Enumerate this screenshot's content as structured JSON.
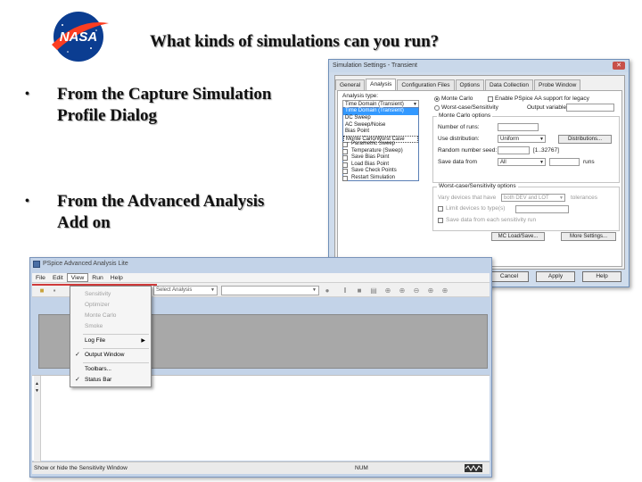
{
  "slide": {
    "logo_text": "NASA",
    "title": "What kinds of simulations can you run?",
    "bullets": [
      {
        "line1": "From the Capture Simulation",
        "line2": "Profile Dialog"
      },
      {
        "line1": "From the Advanced Analysis",
        "line2": "Add on"
      }
    ],
    "bullet_glyph": "•"
  },
  "dialog": {
    "title": "Simulation Settings - Transient",
    "tabs": [
      "General",
      "Analysis",
      "Configuration Files",
      "Options",
      "Data Collection",
      "Probe Window"
    ],
    "active_tab": "Analysis",
    "analysis_type_label": "Analysis type:",
    "analysis_type_value": "Time Domain (Transient)",
    "analysis_types": [
      "Time Domain (Transient)",
      "DC Sweep",
      "AC Sweep/Noise",
      "Bias Point",
      "Monte Carlo/Worst Case"
    ],
    "options_label": "Options",
    "options": [
      {
        "label": "Parametric Sweep",
        "checked": false
      },
      {
        "label": "Temperature (Sweep)",
        "checked": false
      },
      {
        "label": "Save Bias Point",
        "checked": false
      },
      {
        "label": "Load Bias Point",
        "checked": false
      },
      {
        "label": "Save Check Points",
        "checked": false
      },
      {
        "label": "Restart Simulation",
        "checked": false
      }
    ],
    "radio_montecarlo": "Monte Carlo",
    "radio_worstcase": "Worst-case/Sensitivity",
    "enable_label": "Enable PSpice AA support for legacy",
    "output_var_label": "Output variable:",
    "mc_options_title": "Monte Carlo options",
    "number_of_runs_label": "Number of runs:",
    "use_distribution_label": "Use distribution:",
    "use_distribution_value": "Uniform",
    "distributions_button": "Distributions...",
    "random_seed_label": "Random number seed:",
    "random_seed_range": "[1..32767]",
    "save_data_label": "Save data from",
    "save_data_value": "All",
    "runs_label": "runs",
    "wc_options_title": "Worst-case/Sensitivity options",
    "vary_devices_label": "Vary devices that have",
    "vary_devices_value": "both DEV and LOT",
    "tolerances_label": "tolerances",
    "limit_devices_label": "Limit devices to type(s)",
    "save_each_label": "Save data from each sensitivity run",
    "mc_load_save_button": "MC Load/Save...",
    "more_settings_button": "More Settings...",
    "buttons": {
      "ok": "OK",
      "cancel": "Cancel",
      "apply": "Apply",
      "help": "Help"
    }
  },
  "pspice": {
    "title": "PSpice Advanced Analysis Lite",
    "menus": [
      "File",
      "Edit",
      "View",
      "Run",
      "Help"
    ],
    "active_menu": "View",
    "select_analysis": "Select Analysis",
    "view_menu": [
      {
        "label": "Sensitivity",
        "disabled": true,
        "checked": false
      },
      {
        "label": "Optimizer",
        "disabled": true,
        "checked": false
      },
      {
        "label": "Monte Carlo",
        "disabled": true,
        "checked": false
      },
      {
        "label": "Smoke",
        "disabled": true,
        "checked": false
      },
      {
        "label": "Log File",
        "disabled": false,
        "checked": false,
        "submenu": true
      },
      {
        "label": "Output Window",
        "disabled": false,
        "checked": true
      },
      {
        "label": "Toolbars...",
        "disabled": false,
        "checked": false
      },
      {
        "label": "Status Bar",
        "disabled": false,
        "checked": true
      }
    ],
    "status_text": "Show or hide the Sensitivity Window",
    "status_num": "NUM"
  },
  "colors": {
    "nasa_blue": "#0b3d91",
    "nasa_red": "#fc3d21",
    "selection_blue": "#3399ff",
    "toolbar_red_line": "#d03a3a"
  },
  "icons": [
    "nasa-logo",
    "close-icon",
    "app-icon",
    "open-folder-icon",
    "save-icon",
    "zoom-icon",
    "play-icon",
    "waveform-icon"
  ]
}
